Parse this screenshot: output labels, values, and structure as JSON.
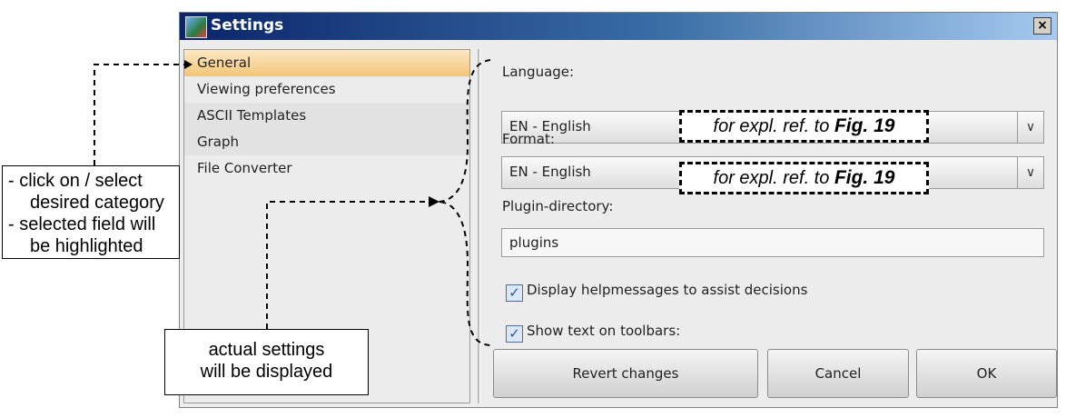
{
  "window": {
    "title": "Settings",
    "close_label": "×"
  },
  "categories": [
    {
      "label": "General",
      "selected": true
    },
    {
      "label": "Viewing preferences",
      "selected": false
    },
    {
      "label": "ASCII Templates",
      "selected": false
    },
    {
      "label": "Graph",
      "selected": false
    },
    {
      "label": "File Converter",
      "selected": false
    }
  ],
  "general": {
    "language_label": "Language:",
    "language_value": "EN - English",
    "format_label": "Format:",
    "format_value": "EN - English",
    "plugin_label": "Plugin-directory:",
    "plugin_value": "plugins",
    "helpmessages_label": "Display helpmessages to assist decisions",
    "helpmessages_checked": true,
    "toolbar_text_label": "Show text on toolbars:",
    "toolbar_text_checked": true
  },
  "buttons": {
    "revert": "Revert changes",
    "cancel": "Cancel",
    "ok": "OK"
  },
  "annotations": {
    "expl_prefix": "for expl. ref. to",
    "expl_fig": "Fig. 19",
    "left_callout": [
      "- click on / select",
      "desired category",
      "- selected field will",
      "be highlighted"
    ],
    "bottom_callout": [
      "actual settings",
      "will be displayed"
    ]
  },
  "icons": {
    "dropdown": "chevron-down-icon",
    "check": "checkmark-icon",
    "app": "settings-app-icon"
  }
}
